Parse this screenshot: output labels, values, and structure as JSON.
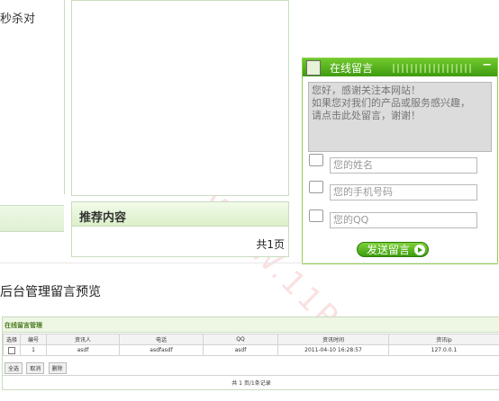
{
  "left": {
    "snippet": "秒杀对"
  },
  "recommend": {
    "title": "推荐内容",
    "pager": "共1页"
  },
  "widget": {
    "title": "在线留言",
    "minimize": "−",
    "message_placeholder": "您好，感谢关注本网站！\n如果您对我们的产品或服务感兴趣，\n请点击此处留言，谢谢！",
    "name_placeholder": "您的姓名",
    "phone_placeholder": "您的手机号码",
    "qq_placeholder": "您的QQ",
    "send_label": "发送留言"
  },
  "section_title": "后台管理留言预览",
  "admin": {
    "title": "在线留言管理",
    "columns": [
      "选择",
      "编号",
      "资讯人",
      "电话",
      "QQ",
      "资讯时间",
      "资讯ip"
    ],
    "rows": [
      {
        "id": "1",
        "name": "asdf",
        "phone": "asdfasdf",
        "qq": "asdf",
        "time": "2011-04-10 16:28:57",
        "ip": "127.0.0.1"
      }
    ],
    "buttons": [
      "全选",
      "取消",
      "删除"
    ],
    "pager": "共 1 页/1条记录"
  },
  "watermark": "精准像素 - WWW.11PX.CN"
}
